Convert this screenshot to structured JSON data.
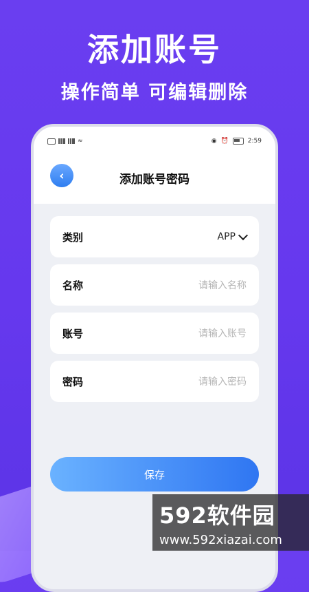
{
  "promo": {
    "headline": "添加账号",
    "subline": "操作简单  可编辑删除"
  },
  "status_bar": {
    "time": "2:59"
  },
  "header": {
    "title": "添加账号密码",
    "back_icon": "chevron-left-icon"
  },
  "form": {
    "category": {
      "label": "类别",
      "value": "APP"
    },
    "name": {
      "label": "名称",
      "placeholder": "请输入名称"
    },
    "account": {
      "label": "账号",
      "placeholder": "请输入账号"
    },
    "password": {
      "label": "密码",
      "placeholder": "请输入密码"
    }
  },
  "actions": {
    "save_label": "保存"
  },
  "watermark": {
    "brand": "592软件园",
    "url": "www.592xiazai.com"
  },
  "colors": {
    "background": "#6a3ef0",
    "accent": "#2f7ef0"
  }
}
